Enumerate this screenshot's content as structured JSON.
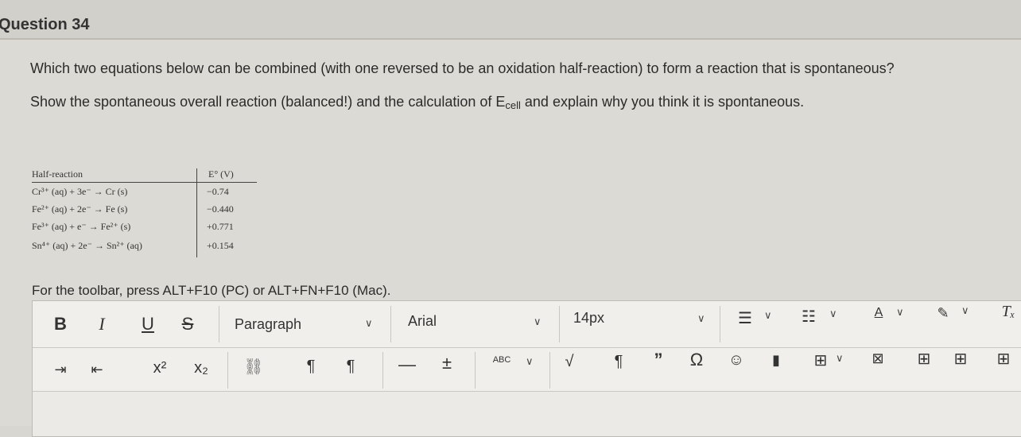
{
  "question": {
    "title": "Question 34",
    "line1": "Which two equations below can be combined (with one reversed to be an oxidation half-reaction) to form a reaction that is spontaneous?",
    "line2_pre": "Show the spontaneous overall reaction (balanced!) and the calculation of E",
    "line2_sub": "cell",
    "line2_post": " and explain why you think it is spontaneous."
  },
  "table": {
    "header_reaction": "Half-reaction",
    "header_e": "E° (V)",
    "rows": [
      {
        "reaction": "Cr³⁺ (aq) + 3e⁻ → Cr (s)",
        "e": "−0.74"
      },
      {
        "reaction": "Fe²⁺ (aq) + 2e⁻ → Fe (s)",
        "e": "−0.440"
      },
      {
        "reaction": "Fe³⁺ (aq) + e⁻ → Fe²⁺ (s)",
        "e": "+0.771"
      },
      {
        "reaction": "Sn⁴⁺ (aq) + 2e⁻ → Sn²⁺ (aq)",
        "e": "+0.154"
      }
    ]
  },
  "hint": "For the toolbar, press ALT+F10 (PC) or ALT+FN+F10 (Mac).",
  "toolbar": {
    "bold": "B",
    "italic": "I",
    "underline": "U",
    "strike": "S",
    "paragraph": "Paragraph",
    "font": "Arial",
    "size": "14px",
    "text_color": "A",
    "superscript": "x²",
    "subscript": "x₂",
    "spellcheck": "ABC"
  }
}
